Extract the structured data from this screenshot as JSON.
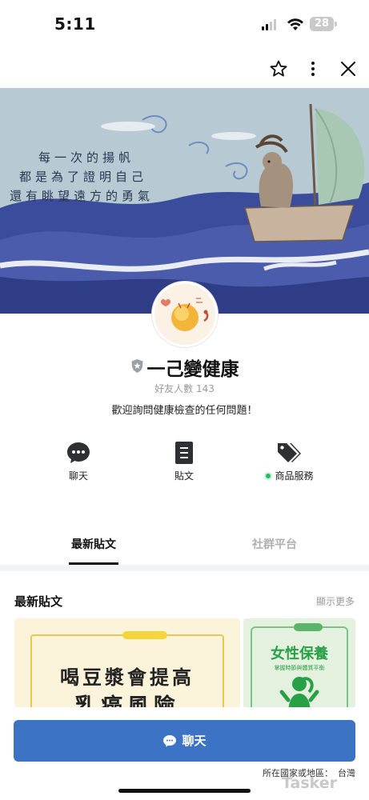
{
  "status_bar": {
    "time": "5:11",
    "battery": "28"
  },
  "cover": {
    "poem_lines": [
      "每一次的揚帆",
      "都是為了證明自己",
      "還有眺望遠方的勇氣"
    ]
  },
  "profile": {
    "name": "一己變健康",
    "friends": "好友人數 143",
    "welcome": "歡迎詢問健康檢查的任何問題！"
  },
  "quick_actions": [
    {
      "label": "聊天",
      "icon": "chat-bubble-icon"
    },
    {
      "label": "貼文",
      "icon": "document-icon"
    },
    {
      "label": "商品服務",
      "icon": "price-tag-icon"
    }
  ],
  "tabs": [
    {
      "label": "最新貼文",
      "active": true
    },
    {
      "label": "社群平台",
      "active": false
    }
  ],
  "posts_section": {
    "title": "最新貼文",
    "more": "顯示更多",
    "posts": [
      {
        "line1": "喝豆漿會提高",
        "line2": "乳癌風險"
      },
      {
        "title": "女性保養",
        "subtitle": "掌握時節與體質平衡"
      }
    ]
  },
  "chat_button": "聊天",
  "region": {
    "label": "所在國家或地區：",
    "value": "台灣"
  },
  "watermark": "Tasker",
  "colors": {
    "accent": "#3d73c4",
    "online": "#20c05c",
    "sea": "#3d4f9e",
    "sky": "#b9ccd6"
  }
}
